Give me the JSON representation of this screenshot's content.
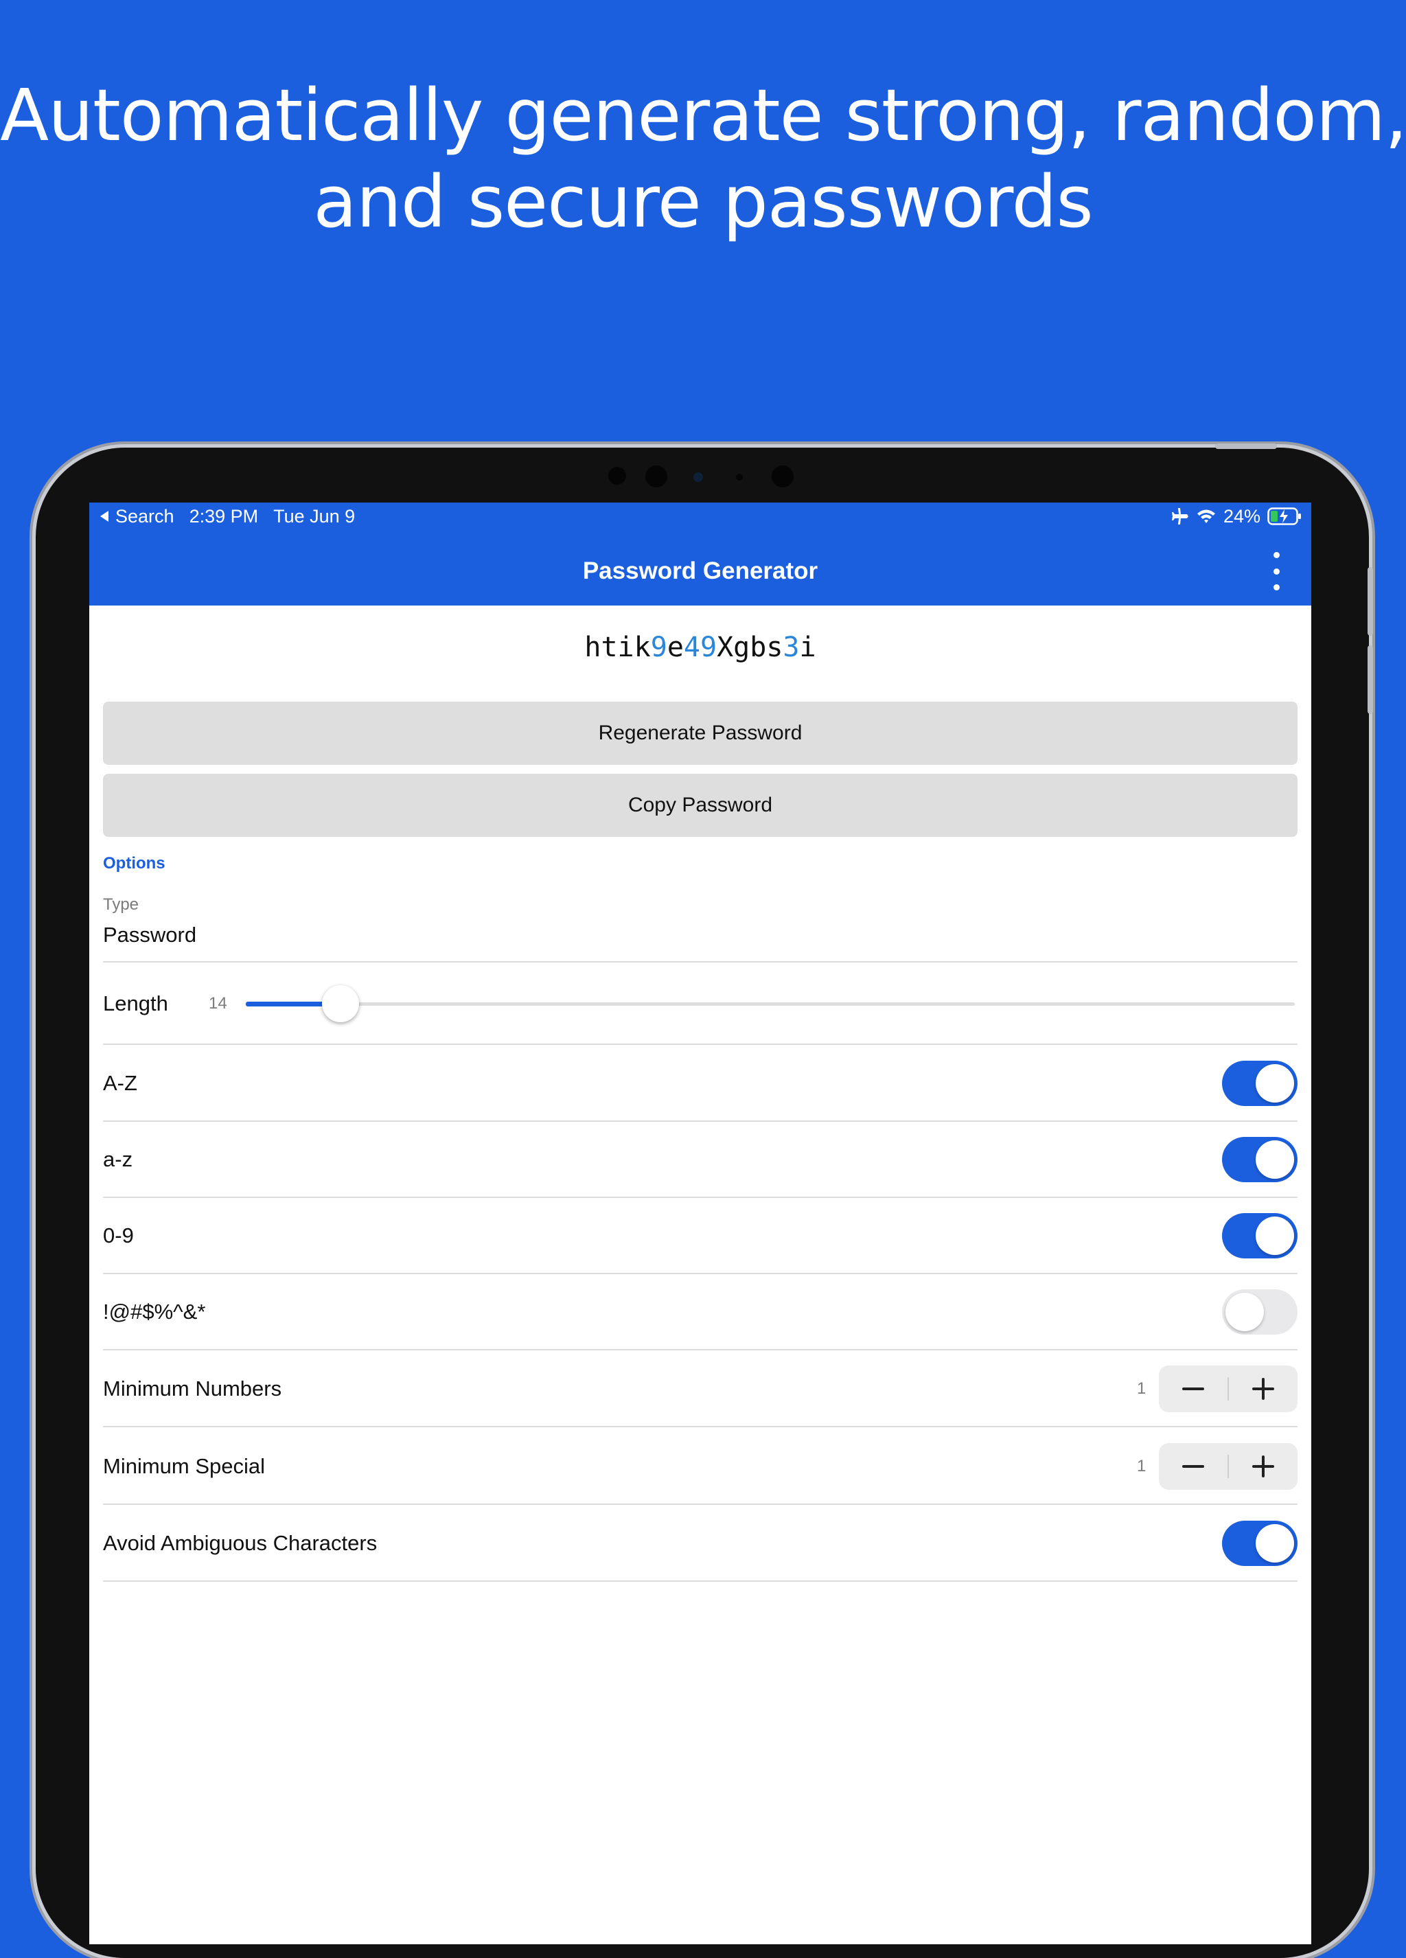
{
  "headline": {
    "line1": "Automatically generate strong, random,",
    "line2": "and secure passwords"
  },
  "status_bar": {
    "back_label": "Search",
    "time": "2:39 PM",
    "date": "Tue Jun 9",
    "battery": "24%",
    "icons": [
      "back-arrow-icon",
      "airplane-icon",
      "wifi-icon",
      "battery-charging-icon"
    ]
  },
  "app_bar": {
    "title": "Password Generator",
    "menu_icon": "more-vertical-icon"
  },
  "password": {
    "segments": [
      {
        "text": "htik",
        "digit": false
      },
      {
        "text": "9",
        "digit": true
      },
      {
        "text": "e",
        "digit": false
      },
      {
        "text": "49",
        "digit": true
      },
      {
        "text": "Xgbs",
        "digit": false
      },
      {
        "text": "3",
        "digit": true
      },
      {
        "text": "i",
        "digit": false
      }
    ],
    "digit_color": "#2a86d8"
  },
  "actions": {
    "regenerate_label": "Regenerate Password",
    "copy_label": "Copy Password"
  },
  "options": {
    "section_label": "Options",
    "type_label": "Type",
    "type_value": "Password",
    "length_label": "Length",
    "length_value": "14",
    "length_fraction": 0.09,
    "uppercase_label": "A-Z",
    "uppercase_on": true,
    "lowercase_label": "a-z",
    "lowercase_on": true,
    "numbers_label": "0-9",
    "numbers_on": true,
    "special_label": "!@#$%^&*",
    "special_on": false,
    "min_numbers_label": "Minimum Numbers",
    "min_numbers_value": "1",
    "min_special_label": "Minimum Special",
    "min_special_value": "1",
    "avoid_ambiguous_label": "Avoid Ambiguous Characters",
    "avoid_ambiguous_on": true
  },
  "colors": {
    "brand": "#1b5fde",
    "background": "#1b5fde",
    "button_gray": "#dedede"
  }
}
